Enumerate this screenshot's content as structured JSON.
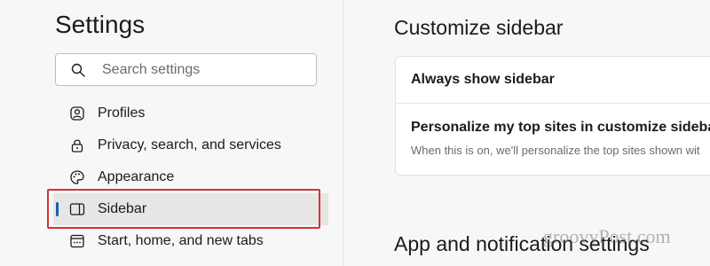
{
  "sidebar": {
    "title": "Settings",
    "search": {
      "placeholder": "Search settings",
      "icon": "search-icon"
    },
    "items": [
      {
        "label": "Profiles",
        "icon": "profile-icon",
        "active": false
      },
      {
        "label": "Privacy, search, and services",
        "icon": "lock-icon",
        "active": false
      },
      {
        "label": "Appearance",
        "icon": "palette-icon",
        "active": false
      },
      {
        "label": "Sidebar",
        "icon": "sidebar-icon",
        "active": true
      },
      {
        "label": "Start, home, and new tabs",
        "icon": "start-home-icon",
        "active": false
      }
    ]
  },
  "main": {
    "title": "Customize sidebar",
    "card": {
      "row1_label": "Always show sidebar",
      "row2_label": "Personalize my top sites in customize sidebar",
      "row2_description": "When this is on, we'll personalize the top sites shown wit"
    },
    "section2_title": "App and notification settings"
  },
  "watermark": "groovyPost.com",
  "colors": {
    "accent": "#1a5fb4",
    "highlight_border": "#d13438",
    "background": "#f7f7f7",
    "card_background": "#ffffff"
  }
}
